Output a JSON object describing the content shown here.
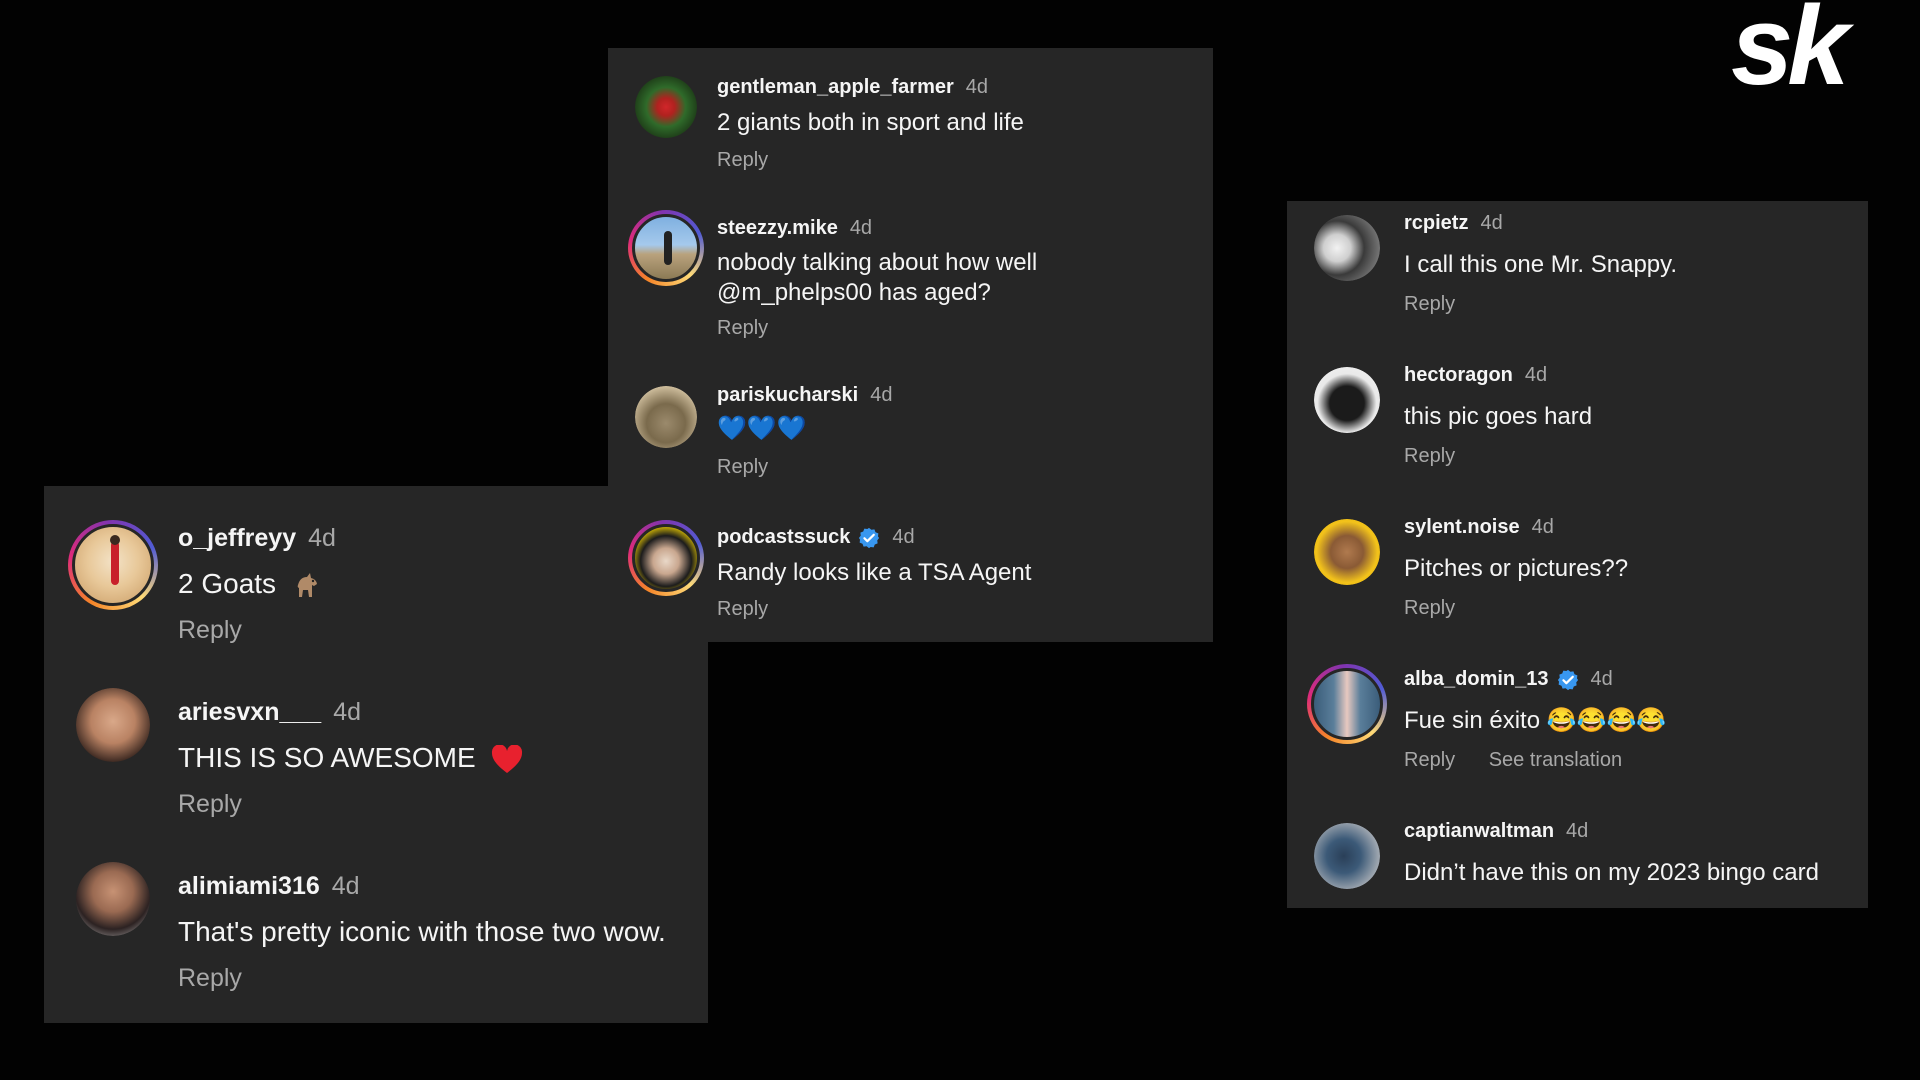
{
  "brand": {
    "logo_text": "sk",
    "logo_color": "#ffffff"
  },
  "colors": {
    "panel": "#262626",
    "background": "#020202",
    "muted": "#a8a8a8",
    "verified": "#3897f0"
  },
  "panels": {
    "left": {
      "comments": [
        {
          "username": "o_jeffreyy",
          "time": "4d",
          "text": "2 Goats",
          "emoji": "goat",
          "reply": "Reply",
          "story_ring": true,
          "verified": false
        },
        {
          "username": "ariesvxn___",
          "time": "4d",
          "text": "THIS IS SO AWESOME",
          "emoji": "red-heart",
          "reply": "Reply",
          "story_ring": false,
          "verified": false
        },
        {
          "username": "alimiami316",
          "time": "4d",
          "text": "That's pretty iconic with those two wow.",
          "reply": "Reply",
          "story_ring": false,
          "verified": false
        }
      ]
    },
    "middle": {
      "comments": [
        {
          "username": "gentleman_apple_farmer",
          "time": "4d",
          "text": "2 giants both in sport and life",
          "reply": "Reply",
          "story_ring": false,
          "verified": false
        },
        {
          "username": "steezzy.mike",
          "time": "4d",
          "text": "nobody talking about how well @m_phelps00 has aged?",
          "reply": "Reply",
          "story_ring": true,
          "verified": false
        },
        {
          "username": "pariskucharski",
          "time": "4d",
          "text": "💙💙💙",
          "reply": "Reply",
          "story_ring": false,
          "verified": false
        },
        {
          "username": "podcastssuck",
          "time": "4d",
          "text": "Randy looks like a TSA Agent",
          "reply": "Reply",
          "story_ring": true,
          "verified": true
        }
      ]
    },
    "right": {
      "comments": [
        {
          "username": "rcpietz",
          "time": "4d",
          "text": "I call this one Mr. Snappy.",
          "reply": "Reply",
          "story_ring": false,
          "verified": false
        },
        {
          "username": "hectoragon",
          "time": "4d",
          "text": "this pic goes hard",
          "reply": "Reply",
          "story_ring": false,
          "verified": false
        },
        {
          "username": "sylent.noise",
          "time": "4d",
          "text": "Pitches or pictures??",
          "reply": "Reply",
          "story_ring": false,
          "verified": false
        },
        {
          "username": "alba_domin_13",
          "time": "4d",
          "text": "Fue sin éxito 😂😂😂😂",
          "reply": "Reply",
          "translate": "See translation",
          "story_ring": true,
          "verified": true
        },
        {
          "username": "captianwaltman",
          "time": "4d",
          "text": "Didn’t have this on my 2023 bingo card",
          "story_ring": false,
          "verified": false
        }
      ]
    }
  }
}
